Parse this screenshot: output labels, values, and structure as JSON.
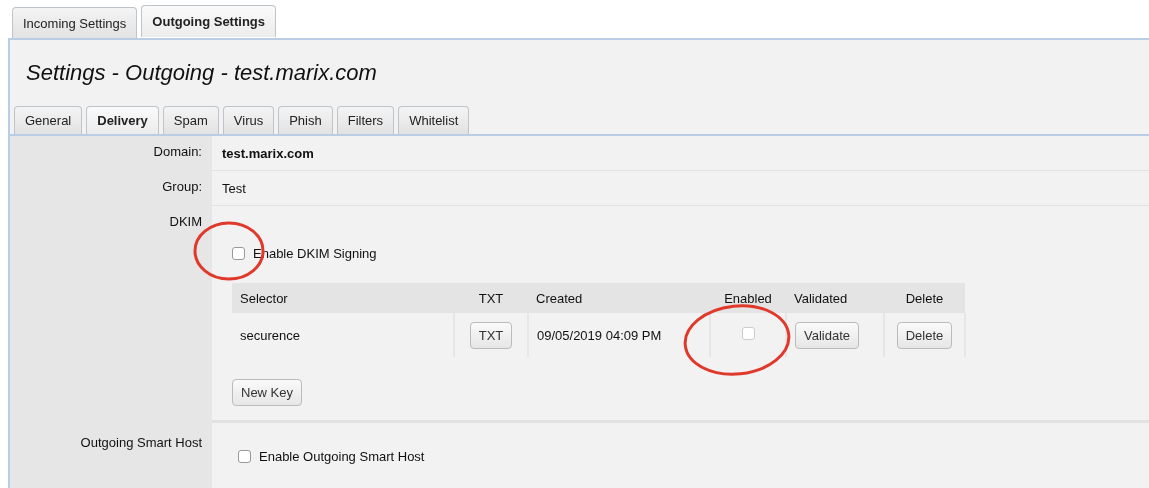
{
  "outer_tabs": [
    {
      "label": "Incoming Settings",
      "selected": false
    },
    {
      "label": "Outgoing Settings",
      "selected": true
    }
  ],
  "title": "Settings - Outgoing - test.marix.com",
  "tabs": [
    {
      "label": "General",
      "selected": false
    },
    {
      "label": "Delivery",
      "selected": true
    },
    {
      "label": "Spam",
      "selected": false
    },
    {
      "label": "Virus",
      "selected": false
    },
    {
      "label": "Phish",
      "selected": false
    },
    {
      "label": "Filters",
      "selected": false
    },
    {
      "label": "Whitelist",
      "selected": false
    }
  ],
  "fields": [
    {
      "label": "Domain:",
      "value": "test.marix.com"
    },
    {
      "label": "Group:",
      "value": "Test"
    }
  ],
  "dkim": {
    "label": "DKIM",
    "checkbox": {
      "label": "Enable DKIM Signing",
      "checked": false
    },
    "table": {
      "columns": [
        "Selector",
        "TXT",
        "Created",
        "Enabled",
        "Validated",
        "Delete"
      ],
      "rows": [
        {
          "selector": "securence",
          "txt_button": "TXT",
          "created": "09/05/2019 04:09 PM",
          "enabled": false,
          "validate_button": "Validate",
          "delete_button": "Delete"
        }
      ]
    },
    "new_key_button": "New Key"
  },
  "smart_host": {
    "label": "Outgoing Smart Host",
    "checkbox": {
      "label": "Enable Outgoing Smart Host",
      "checked": false
    }
  }
}
